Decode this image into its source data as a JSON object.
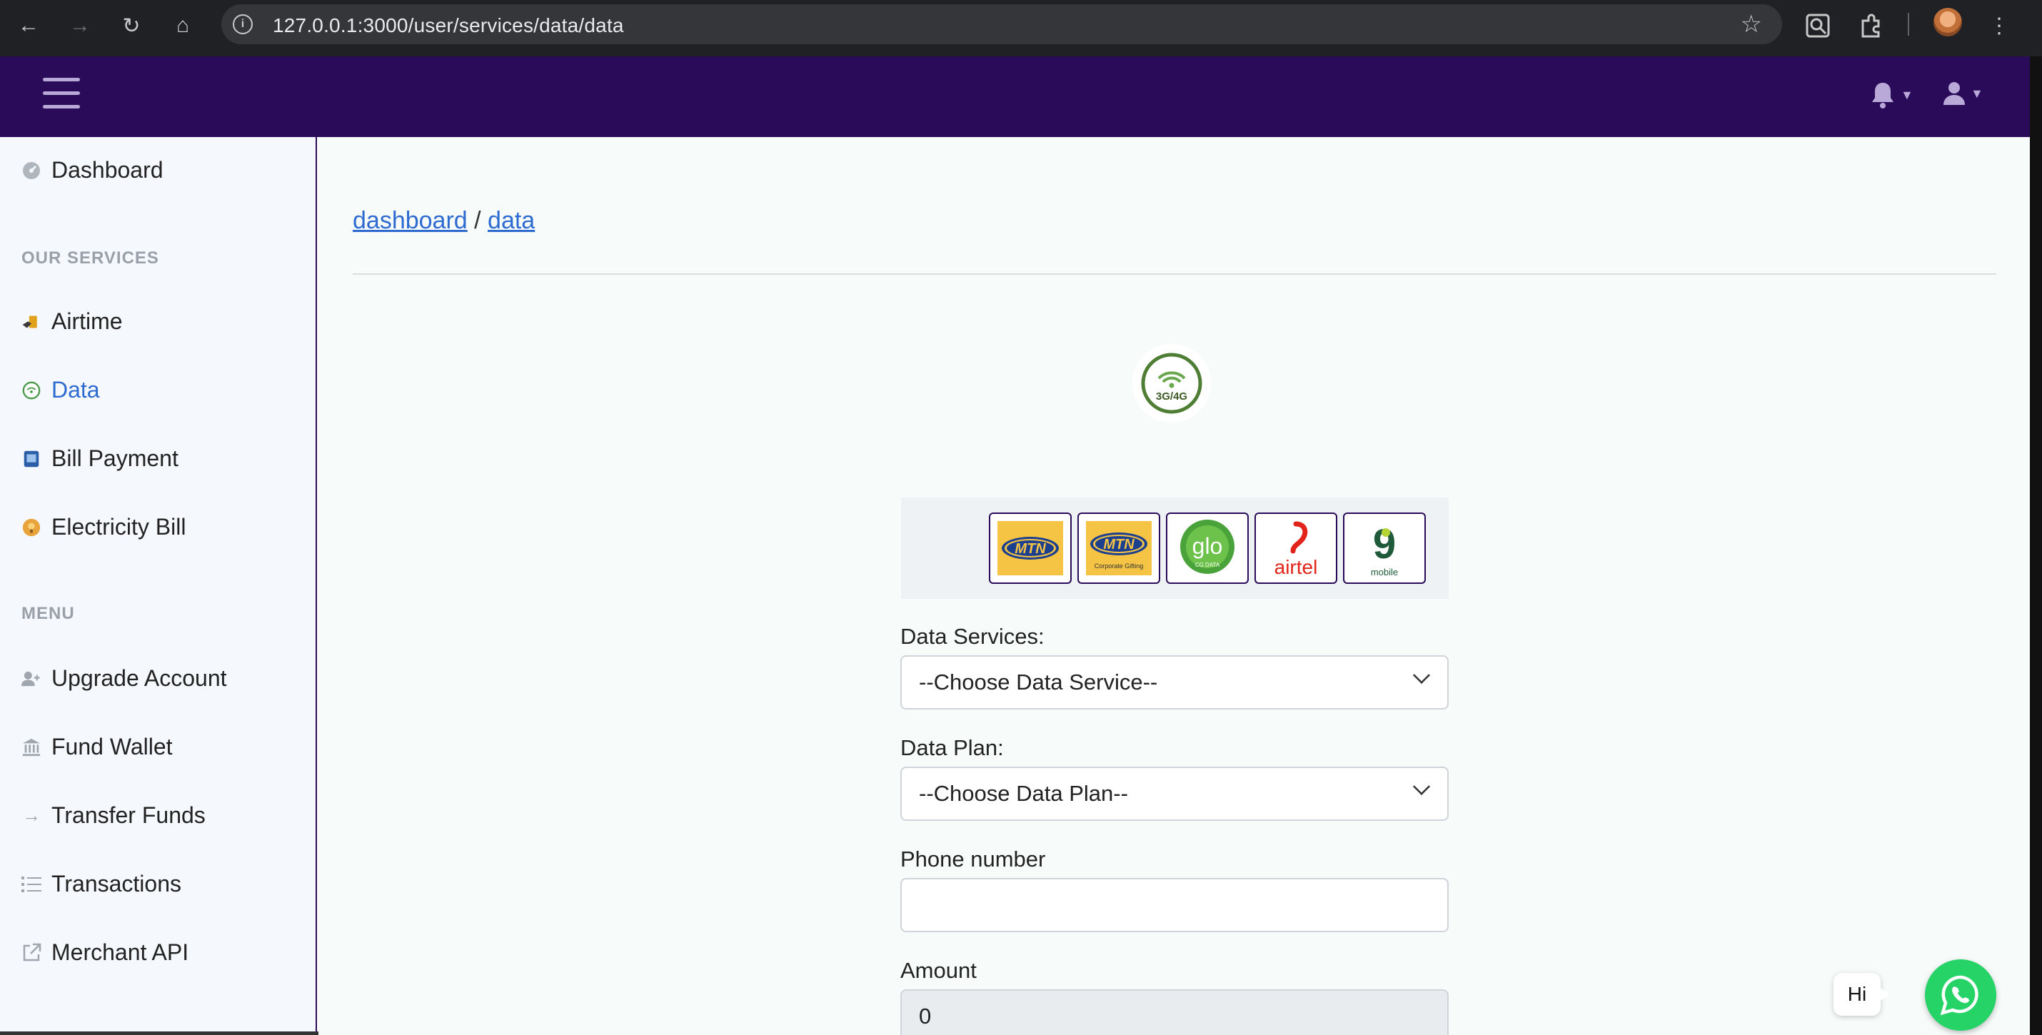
{
  "browser": {
    "url": "127.0.0.1:3000/user/services/data/data"
  },
  "sidebar": {
    "dashboard": "Dashboard",
    "services_heading": "OUR SERVICES",
    "services": [
      {
        "label": "Airtime"
      },
      {
        "label": "Data",
        "active": true
      },
      {
        "label": "Bill Payment"
      },
      {
        "label": "Electricity Bill"
      }
    ],
    "menu_heading": "MENU",
    "menu": [
      {
        "label": "Upgrade Account"
      },
      {
        "label": "Fund Wallet"
      },
      {
        "label": "Transfer Funds"
      },
      {
        "label": "Transactions"
      },
      {
        "label": "Merchant API"
      }
    ]
  },
  "breadcrumb": {
    "home": "dashboard",
    "separator": "/",
    "current": "data"
  },
  "data_logo_text": "3G/4G",
  "networks": [
    {
      "name": "MTN",
      "label": "MTN"
    },
    {
      "name": "MTN Corporate Gifting",
      "label": "MTN",
      "sublabel": "Corporate Gifting"
    },
    {
      "name": "Glo",
      "label": "glo",
      "sublabel": "CG DATA"
    },
    {
      "name": "Airtel",
      "label": "airtel"
    },
    {
      "name": "9mobile",
      "label": "9",
      "sublabel": "mobile"
    }
  ],
  "form": {
    "service_label": "Data Services:",
    "service_value": "--Choose Data Service--",
    "plan_label": "Data Plan:",
    "plan_value": "--Choose Data Plan--",
    "phone_label": "Phone number",
    "phone_value": "",
    "amount_label": "Amount",
    "amount_value": "0"
  },
  "chat": {
    "greeting": "Hi"
  },
  "colors": {
    "topbar": "#2a0b5a",
    "accent": "#2e6bd1",
    "whatsapp": "#25d366"
  }
}
